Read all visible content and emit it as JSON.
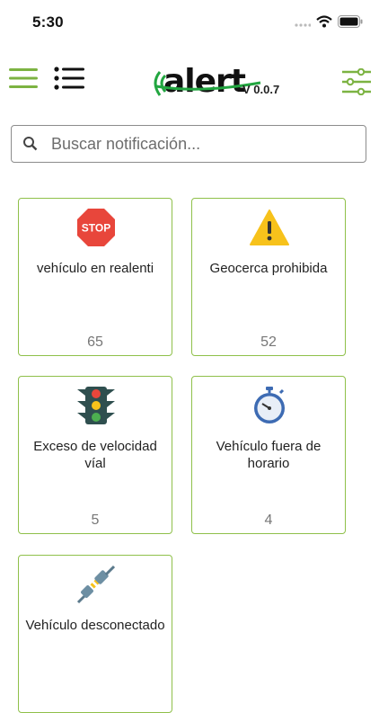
{
  "status_bar": {
    "time": "5:30"
  },
  "header": {
    "logo_text": "alert",
    "version": "V 0.0.7"
  },
  "search": {
    "placeholder": "Buscar notificación..."
  },
  "cards": [
    {
      "label": "vehículo en realenti",
      "count": "65",
      "icon": "stop-sign-icon",
      "icon_text": "STOP"
    },
    {
      "label": "Geocerca prohibida",
      "count": "52",
      "icon": "warning-icon"
    },
    {
      "label": "Exceso de velocidad víal",
      "count": "5",
      "icon": "traffic-light-icon"
    },
    {
      "label": "Vehículo fuera de horario",
      "count": "4",
      "icon": "stopwatch-icon"
    },
    {
      "label": "Vehículo desconectado",
      "count": "",
      "icon": "plug-icon"
    }
  ],
  "colors": {
    "accent": "#8fc04a",
    "logo_green": "#22a640",
    "stop_red": "#e8463b",
    "warning_yellow": "#f7c21b"
  }
}
